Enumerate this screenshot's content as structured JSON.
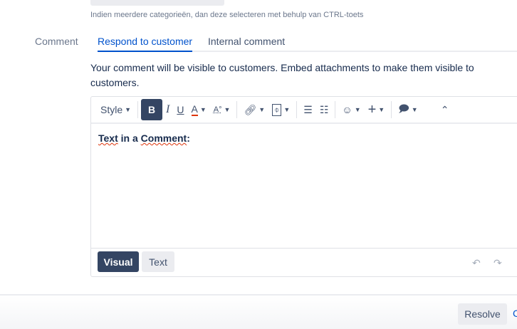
{
  "field": {
    "help_text": "Indien meerdere categorieën, dan deze selecteren met behulp van CTRL-toets"
  },
  "comment": {
    "label": "Comment",
    "tabs": [
      {
        "label": "Respond to customer",
        "active": true
      },
      {
        "label": "Internal comment",
        "active": false
      }
    ],
    "description": "Your comment will be visible to customers. Embed attachments to make them visible to customers."
  },
  "toolbar": {
    "style": "Style",
    "bold": "B",
    "italic": "I",
    "underline": "U",
    "color": "A",
    "more_format": "A°"
  },
  "editor": {
    "content_words": [
      "Text",
      "in a",
      "Comment",
      ":"
    ],
    "modes": {
      "visual": "Visual",
      "text": "Text"
    }
  },
  "footer": {
    "resolve": "Resolve",
    "next": "C"
  },
  "colors": {
    "accent": "#0052cc",
    "dark": "#344563"
  }
}
